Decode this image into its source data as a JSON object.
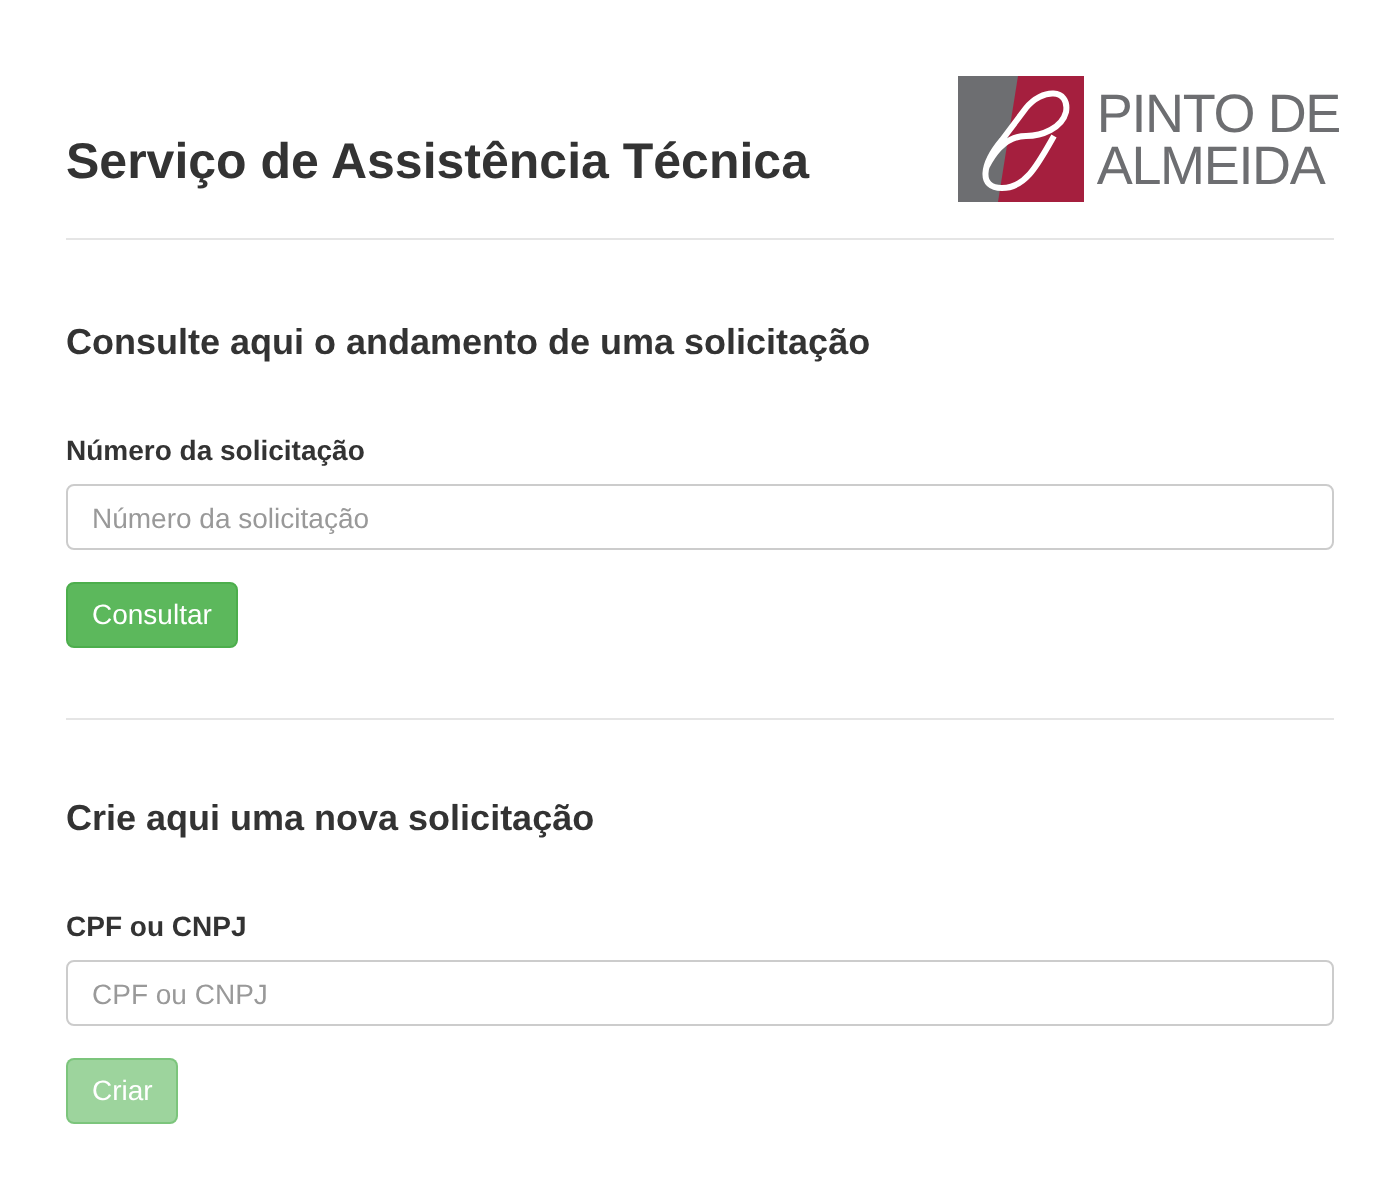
{
  "header": {
    "title": "Serviço de Assistência Técnica",
    "logo_text": [
      "PINTO DE",
      "ALMEIDA"
    ]
  },
  "sections": [
    {
      "heading": "Consulte aqui o andamento de uma solicitação",
      "label": "Número da solicitação",
      "placeholder": "Número da solicitação",
      "button": {
        "label": "Consultar",
        "disabled": false
      }
    },
    {
      "heading": "Crie aqui uma nova solicitação",
      "label": "CPF ou CNPJ",
      "placeholder": "CPF ou CNPJ",
      "button": {
        "label": "Criar",
        "disabled": true
      }
    }
  ]
}
